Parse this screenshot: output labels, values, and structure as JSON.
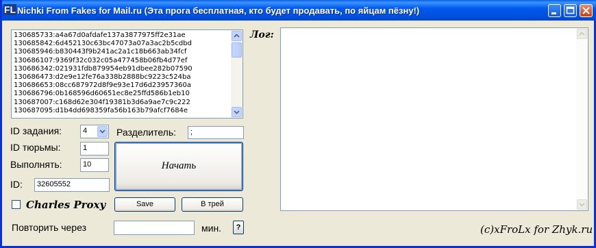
{
  "window": {
    "icon_text": "FL",
    "title": "Nichki From Fakes for Mail.ru (Эта прога бесплатная, кто будет продавать, по яйцам пёзну!)",
    "controls": [
      "minimize-icon",
      "maximize-icon",
      "close-icon"
    ]
  },
  "accounts_list": [
    "130685733:a4a67d0afdafe137a3877975ff2e31ae",
    "130685842:6d452130c63bc47073a07a3ac2b5cdbd",
    "130685946:b830443f9b241ac2a1c18b663ab34fcf",
    "130686107:9369f32c032c05a477458b06fb4d77ef",
    "130686342:021931fdb879954eb91dbee282b07590",
    "130686473:d2e9e12fe76a338b2888bc9223c524ba",
    "130686653:08cc687972d8f9e93e17d6d23957360a",
    "130686796:0b168596d60651ec8e25ffd586b1eb10",
    "130687007:c168d62e304f19381b3d6a9ae7c9c222",
    "130687095:d1b4dd698359fa56b163b79afcf7684e"
  ],
  "form": {
    "task_id_label": "ID задания:",
    "task_id_value": "4",
    "separator_label": "Разделитель:",
    "separator_value": ";",
    "prison_id_label": "ID тюрьмы:",
    "prison_id_value": "1",
    "run_label": "Выполнять:",
    "run_value": "10",
    "id_label": "ID:",
    "id_value": "32605552",
    "charles_proxy_label": "Charles Proxy",
    "repeat_label": "Повторить через",
    "repeat_value": "",
    "minutes_label": "мин.",
    "help_label": "?"
  },
  "buttons": {
    "start": "Начать",
    "save": "Save",
    "tray": "В трей"
  },
  "log": {
    "label": "Лог:",
    "content": ""
  },
  "footer": {
    "credit": "(c)xFroLx for Zhyk.ru"
  }
}
